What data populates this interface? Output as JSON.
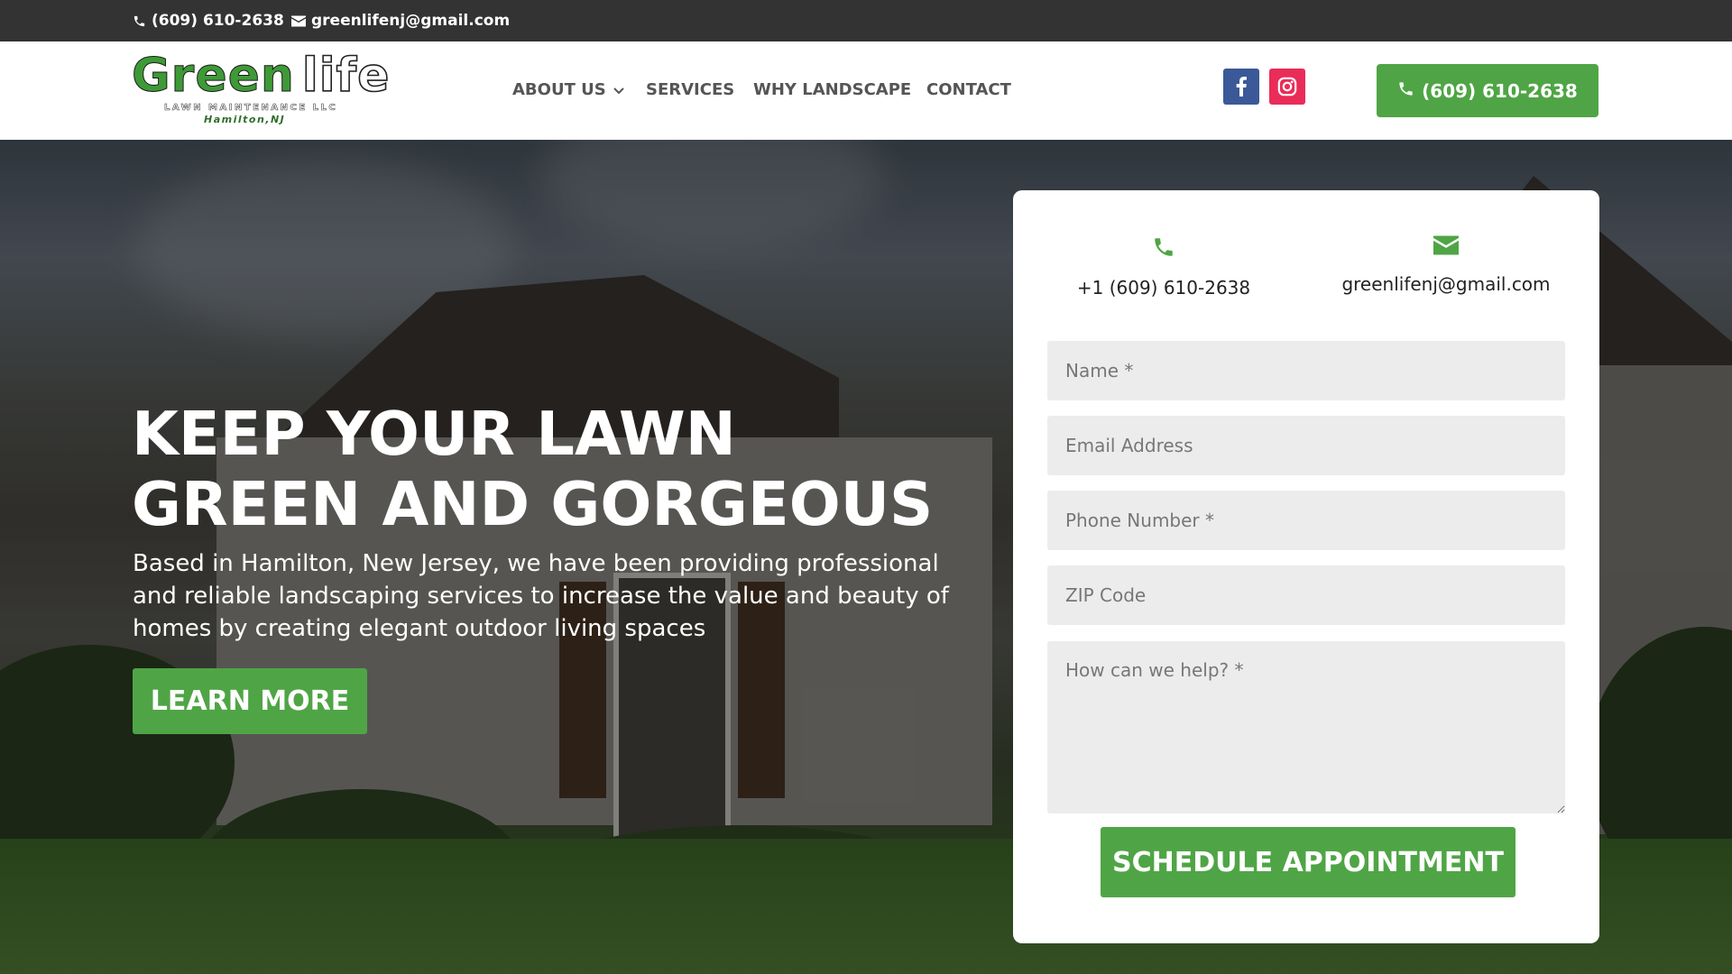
{
  "topbar": {
    "phone": "(609) 610-2638",
    "email": "greenlifenj@gmail.com",
    "phone_icon": "phone-icon",
    "email_icon": "envelope-icon"
  },
  "logo": {
    "word1": "Green",
    "word2": "life",
    "subtitle": "LAWN MAINTENANCE LLC",
    "city": "Hamilton,NJ"
  },
  "nav": {
    "about": "ABOUT US",
    "services": "SERVICES",
    "why": "WHY LANDSCAPE",
    "contact": "CONTACT"
  },
  "social": {
    "facebook_icon": "facebook-icon",
    "instagram_icon": "instagram-icon"
  },
  "header_call": "(609) 610-2638",
  "hero": {
    "title": "KEEP YOUR LAWN GREEN AND GORGEOUS",
    "text": "Based in Hamilton, New Jersey, we have been providing professional and reliable landscaping services to increase the value and beauty of homes by creating elegant outdoor living spaces",
    "button": "LEARN MORE"
  },
  "form": {
    "contact_phone": "+1 (609) 610-2638",
    "contact_email": "greenlifenj@gmail.com",
    "name_placeholder": "Name *",
    "email_placeholder": "Email Address",
    "phone_placeholder": "Phone Number *",
    "zip_placeholder": "ZIP Code",
    "message_placeholder": "How can we help? *",
    "submit": "SCHEDULE APPOINTMENT"
  },
  "colors": {
    "brand_green": "#4fa545",
    "topbar": "#333333",
    "facebook": "#3b5998",
    "instagram": "#ea2c59"
  }
}
